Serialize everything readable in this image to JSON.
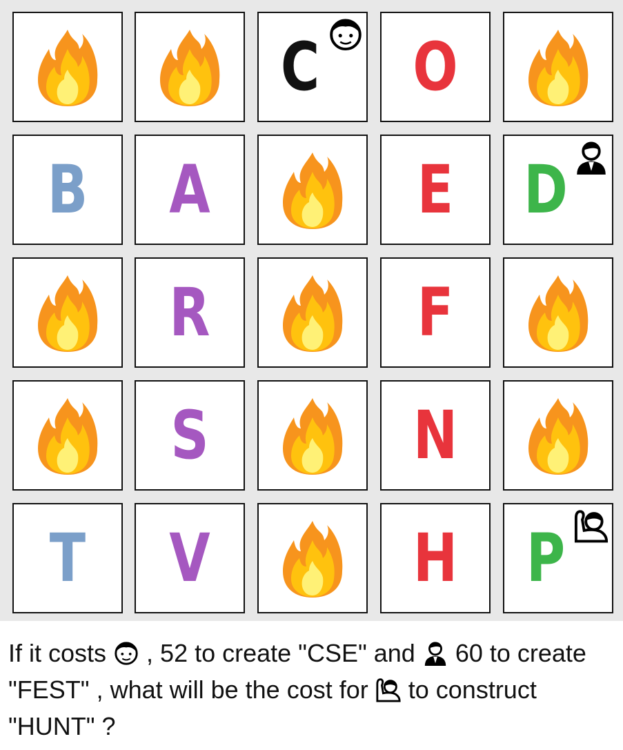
{
  "cells": [
    {
      "type": "fire"
    },
    {
      "type": "fire"
    },
    {
      "type": "letter",
      "letter": "C",
      "color": "#111111",
      "person": "boy"
    },
    {
      "type": "letter",
      "letter": "O",
      "color": "#e8343c"
    },
    {
      "type": "fire"
    },
    {
      "type": "letter",
      "letter": "B",
      "color": "#7b9fc9"
    },
    {
      "type": "letter",
      "letter": "A",
      "color": "#a558c0"
    },
    {
      "type": "fire"
    },
    {
      "type": "letter",
      "letter": "E",
      "color": "#e8343c"
    },
    {
      "type": "letter",
      "letter": "D",
      "color": "#3db54a",
      "person": "businessman"
    },
    {
      "type": "fire"
    },
    {
      "type": "letter",
      "letter": "R",
      "color": "#a558c0"
    },
    {
      "type": "fire"
    },
    {
      "type": "letter",
      "letter": "F",
      "color": "#e8343c"
    },
    {
      "type": "fire"
    },
    {
      "type": "fire"
    },
    {
      "type": "letter",
      "letter": "S",
      "color": "#a558c0"
    },
    {
      "type": "fire"
    },
    {
      "type": "letter",
      "letter": "N",
      "color": "#e8343c"
    },
    {
      "type": "fire"
    },
    {
      "type": "letter",
      "letter": "T",
      "color": "#7b9fc9"
    },
    {
      "type": "letter",
      "letter": "V",
      "color": "#a558c0"
    },
    {
      "type": "fire"
    },
    {
      "type": "letter",
      "letter": "H",
      "color": "#e8343c"
    },
    {
      "type": "letter",
      "letter": "P",
      "color": "#3db54a",
      "person": "raising-hand"
    }
  ],
  "question": {
    "part1": "If it costs ",
    "part2": " , 52 to create \"CSE\" and ",
    "part3": " 60 to create \"FEST\" , what will be the cost for ",
    "part4": "  to construct \"HUNT\" ?"
  }
}
